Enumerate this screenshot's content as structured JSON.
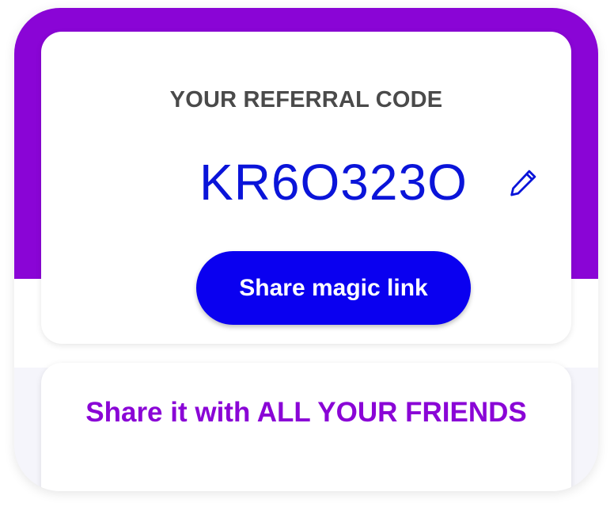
{
  "referral": {
    "heading": "YOUR REFERRAL CODE",
    "code": "KR6O323O",
    "edit_icon": "pencil-icon",
    "share_button_label": "Share magic link"
  },
  "share_card": {
    "heading": "Share it with ALL YOUR FRIENDS"
  },
  "colors": {
    "accent_purple": "#8a05d6",
    "code_blue": "#0a14d9",
    "button_blue": "#0a00f0",
    "heading_gray": "#4a4a4a"
  }
}
